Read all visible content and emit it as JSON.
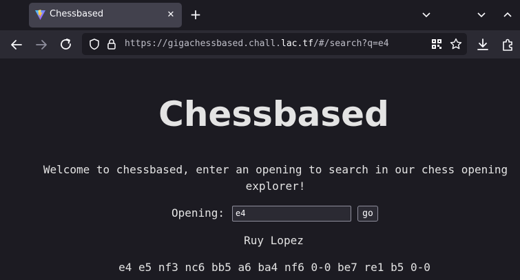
{
  "tab": {
    "title": "Chessbased",
    "favicon": "vite-logo-icon",
    "close_label": "✕",
    "new_tab_label": "+"
  },
  "navbar": {
    "url_scheme": "https://",
    "url_pre": "gigachessbased.chall.",
    "url_host": "lac.tf",
    "url_path": "/#/search?q=e4"
  },
  "page": {
    "title": "Chessbased",
    "welcome": "Welcome to chessbased, enter an opening to search in our chess opening explorer!",
    "opening_label": "Opening:",
    "opening_value": "e4",
    "go_label": "go",
    "result_name": "Ruy Lopez",
    "result_moves": "e4 e5 nf3 nc6 bb5 a6 ba4 nf6 0-0 be7 re1 b5 0-0"
  },
  "colors": {
    "chrome_bg": "#1c1b22",
    "toolbar_bg": "#2b2a33",
    "active_tab": "#42414d",
    "text": "#fbfbfe",
    "page_text": "#e4e4e4"
  }
}
